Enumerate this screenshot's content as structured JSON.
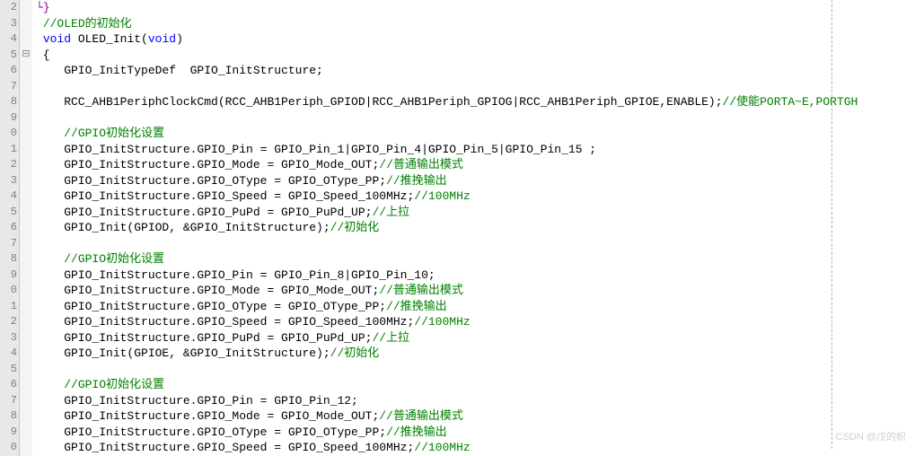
{
  "watermark": "CSDN @戊的帜",
  "lines": [
    {
      "num": "2",
      "fold": "",
      "tokens": [
        {
          "cls": "c-pn",
          "t": "└}"
        }
      ]
    },
    {
      "num": "3",
      "fold": "",
      "tokens": [
        {
          "cls": "",
          "t": " "
        },
        {
          "cls": "c-cm",
          "t": "//OLED的初始化"
        }
      ]
    },
    {
      "num": "4",
      "fold": "",
      "tokens": [
        {
          "cls": "",
          "t": " "
        },
        {
          "cls": "c-kw",
          "t": "void"
        },
        {
          "cls": "",
          "t": " OLED_Init("
        },
        {
          "cls": "c-kw",
          "t": "void"
        },
        {
          "cls": "",
          "t": ")"
        }
      ]
    },
    {
      "num": "5",
      "fold": "⊟",
      "tokens": [
        {
          "cls": "",
          "t": " {"
        }
      ]
    },
    {
      "num": "6",
      "fold": "",
      "tokens": [
        {
          "cls": "",
          "t": "    GPIO_InitTypeDef  GPIO_InitStructure;"
        }
      ]
    },
    {
      "num": "7",
      "fold": "",
      "tokens": [
        {
          "cls": "",
          "t": ""
        }
      ]
    },
    {
      "num": "8",
      "fold": "",
      "tokens": [
        {
          "cls": "",
          "t": "    RCC_AHB1PeriphClockCmd(RCC_AHB1Periph_GPIOD|RCC_AHB1Periph_GPIOG|RCC_AHB1Periph_GPIOE,ENABLE);"
        },
        {
          "cls": "c-cm",
          "t": "//使能PORTA~E,PORTGH"
        }
      ]
    },
    {
      "num": "9",
      "fold": "",
      "tokens": [
        {
          "cls": "",
          "t": ""
        }
      ]
    },
    {
      "num": "0",
      "fold": "",
      "tokens": [
        {
          "cls": "",
          "t": "    "
        },
        {
          "cls": "c-cm",
          "t": "//GPIO初始化设置"
        }
      ]
    },
    {
      "num": "1",
      "fold": "",
      "tokens": [
        {
          "cls": "",
          "t": "    GPIO_InitStructure.GPIO_Pin = GPIO_Pin_1|GPIO_Pin_4|GPIO_Pin_5|GPIO_Pin_15 ;"
        }
      ]
    },
    {
      "num": "2",
      "fold": "",
      "tokens": [
        {
          "cls": "",
          "t": "    GPIO_InitStructure.GPIO_Mode = GPIO_Mode_OUT;"
        },
        {
          "cls": "c-cm",
          "t": "//普通输出模式"
        }
      ]
    },
    {
      "num": "3",
      "fold": "",
      "tokens": [
        {
          "cls": "",
          "t": "    GPIO_InitStructure.GPIO_OType = GPIO_OType_PP;"
        },
        {
          "cls": "c-cm",
          "t": "//推挽输出"
        }
      ]
    },
    {
      "num": "4",
      "fold": "",
      "tokens": [
        {
          "cls": "",
          "t": "    GPIO_InitStructure.GPIO_Speed = GPIO_Speed_100MHz;"
        },
        {
          "cls": "c-cm",
          "t": "//100MHz"
        }
      ]
    },
    {
      "num": "5",
      "fold": "",
      "tokens": [
        {
          "cls": "",
          "t": "    GPIO_InitStructure.GPIO_PuPd = GPIO_PuPd_UP;"
        },
        {
          "cls": "c-cm",
          "t": "//上拉"
        }
      ]
    },
    {
      "num": "6",
      "fold": "",
      "tokens": [
        {
          "cls": "",
          "t": "    GPIO_Init(GPIOD, &GPIO_InitStructure);"
        },
        {
          "cls": "c-cm",
          "t": "//初始化"
        }
      ]
    },
    {
      "num": "7",
      "fold": "",
      "tokens": [
        {
          "cls": "",
          "t": ""
        }
      ]
    },
    {
      "num": "8",
      "fold": "",
      "tokens": [
        {
          "cls": "",
          "t": "    "
        },
        {
          "cls": "c-cm",
          "t": "//GPIO初始化设置"
        }
      ]
    },
    {
      "num": "9",
      "fold": "",
      "tokens": [
        {
          "cls": "",
          "t": "    GPIO_InitStructure.GPIO_Pin = GPIO_Pin_8|GPIO_Pin_10;"
        }
      ]
    },
    {
      "num": "0",
      "fold": "",
      "tokens": [
        {
          "cls": "",
          "t": "    GPIO_InitStructure.GPIO_Mode = GPIO_Mode_OUT;"
        },
        {
          "cls": "c-cm",
          "t": "//普通输出模式"
        }
      ]
    },
    {
      "num": "1",
      "fold": "",
      "tokens": [
        {
          "cls": "",
          "t": "    GPIO_InitStructure.GPIO_OType = GPIO_OType_PP;"
        },
        {
          "cls": "c-cm",
          "t": "//推挽输出"
        }
      ]
    },
    {
      "num": "2",
      "fold": "",
      "tokens": [
        {
          "cls": "",
          "t": "    GPIO_InitStructure.GPIO_Speed = GPIO_Speed_100MHz;"
        },
        {
          "cls": "c-cm",
          "t": "//100MHz"
        }
      ]
    },
    {
      "num": "3",
      "fold": "",
      "tokens": [
        {
          "cls": "",
          "t": "    GPIO_InitStructure.GPIO_PuPd = GPIO_PuPd_UP;"
        },
        {
          "cls": "c-cm",
          "t": "//上拉"
        }
      ]
    },
    {
      "num": "4",
      "fold": "",
      "tokens": [
        {
          "cls": "",
          "t": "    GPIO_Init(GPIOE, &GPIO_InitStructure);"
        },
        {
          "cls": "c-cm",
          "t": "//初始化"
        }
      ]
    },
    {
      "num": "5",
      "fold": "",
      "tokens": [
        {
          "cls": "",
          "t": ""
        }
      ]
    },
    {
      "num": "6",
      "fold": "",
      "tokens": [
        {
          "cls": "",
          "t": "    "
        },
        {
          "cls": "c-cm",
          "t": "//GPIO初始化设置"
        }
      ]
    },
    {
      "num": "7",
      "fold": "",
      "tokens": [
        {
          "cls": "",
          "t": "    GPIO_InitStructure.GPIO_Pin = GPIO_Pin_12;"
        }
      ]
    },
    {
      "num": "8",
      "fold": "",
      "tokens": [
        {
          "cls": "",
          "t": "    GPIO_InitStructure.GPIO_Mode = GPIO_Mode_OUT;"
        },
        {
          "cls": "c-cm",
          "t": "//普通输出模式"
        }
      ]
    },
    {
      "num": "9",
      "fold": "",
      "tokens": [
        {
          "cls": "",
          "t": "    GPIO_InitStructure.GPIO_OType = GPIO_OType_PP;"
        },
        {
          "cls": "c-cm",
          "t": "//推挽输出"
        }
      ]
    },
    {
      "num": "0",
      "fold": "",
      "tokens": [
        {
          "cls": "",
          "t": "    GPIO_InitStructure.GPIO_Speed = GPIO_Speed_100MHz;"
        },
        {
          "cls": "c-cm",
          "t": "//100MHz"
        }
      ]
    }
  ]
}
